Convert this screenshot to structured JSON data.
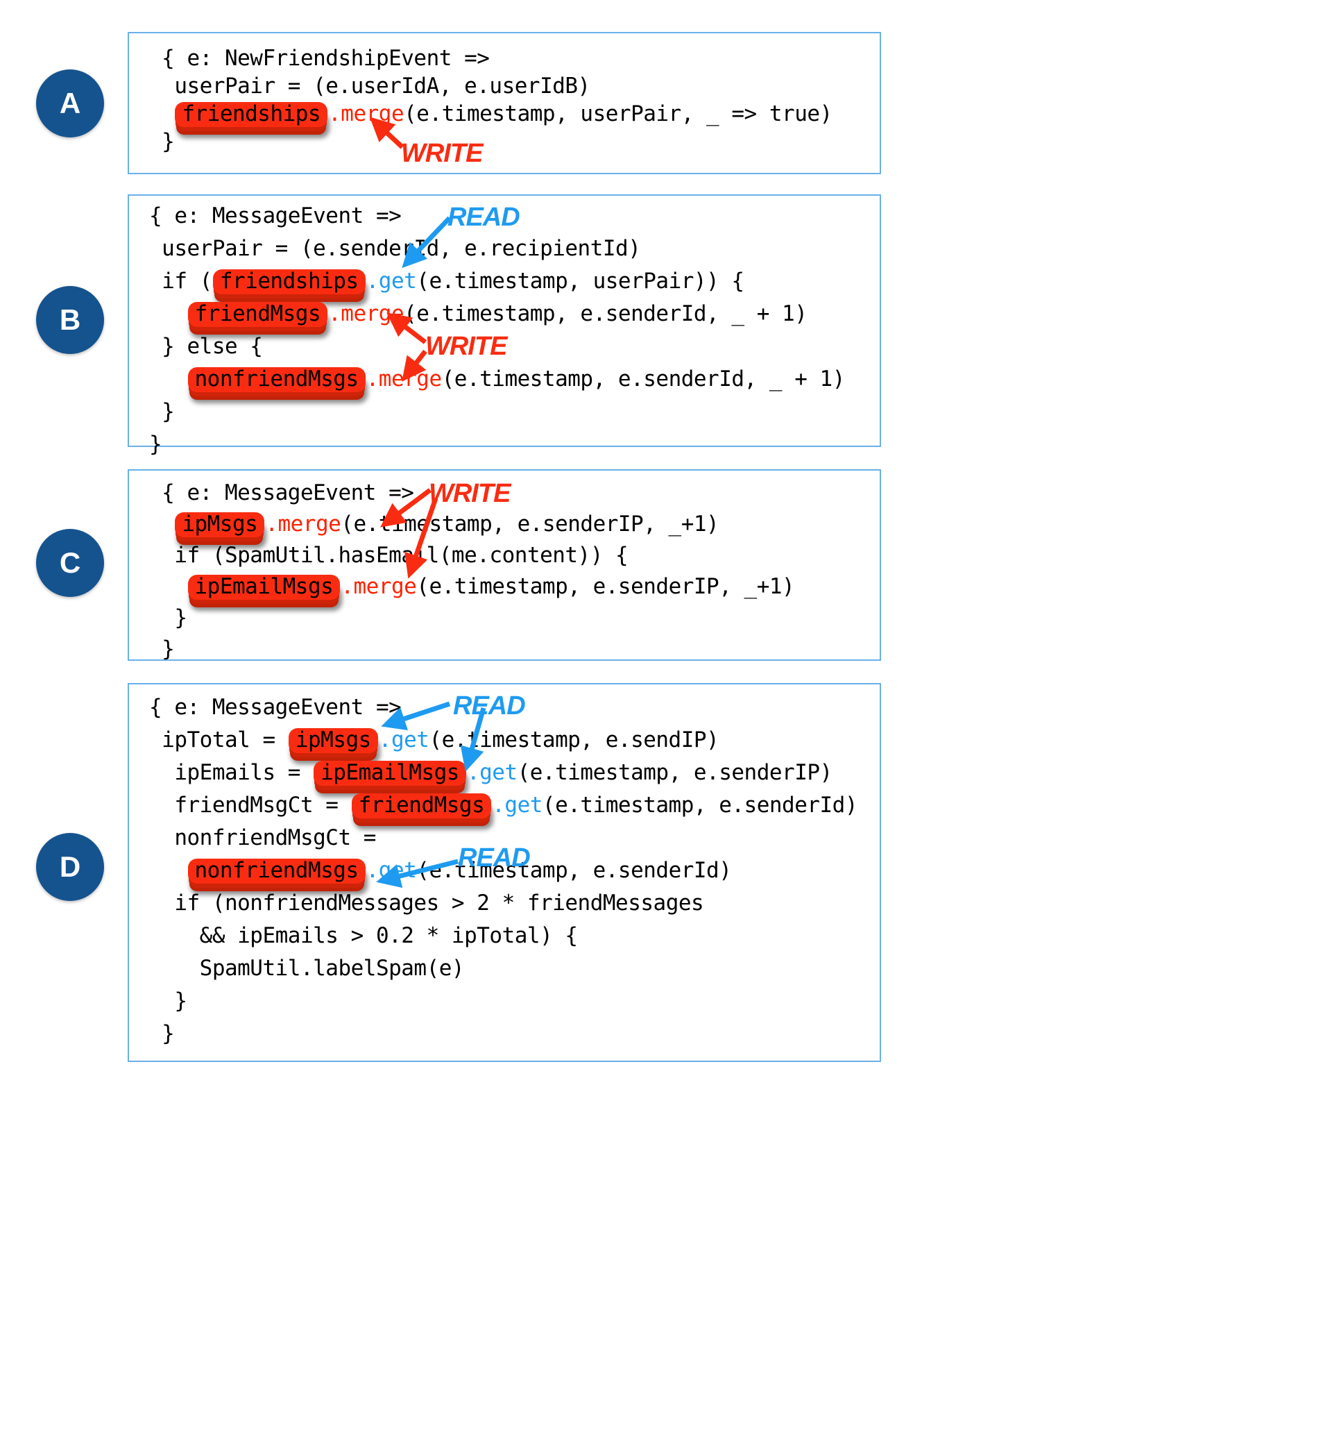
{
  "colors": {
    "panel_border": "#6ab0e8",
    "badge_fill": "#15538f",
    "pill_fill": "#f92c11",
    "pill_shadow": "#c22208",
    "write_color": "#f92c11",
    "read_color": "#1e9bf0",
    "background": "#ffffff",
    "code_color": "#000000"
  },
  "panels": [
    {
      "badge": "A",
      "lines": [
        [
          {
            "t": "plain",
            "v": " { e: NewFriendshipEvent =>"
          }
        ],
        [
          {
            "t": "plain",
            "v": "  userPair = (e.userIdA, e.userIdB)"
          }
        ],
        [
          {
            "t": "plain",
            "v": "  "
          },
          {
            "t": "pill",
            "v": "friendships"
          },
          {
            "t": "merge",
            "v": ".merge"
          },
          {
            "t": "plain",
            "v": "(e.timestamp, userPair, _ => true)"
          }
        ],
        [
          {
            "t": "plain",
            "v": " }"
          }
        ]
      ],
      "annotations": [
        {
          "label": "WRITE",
          "kind": "write"
        }
      ]
    },
    {
      "badge": "B",
      "lines": [
        [
          {
            "t": "plain",
            "v": "{ e: MessageEvent =>"
          }
        ],
        [
          {
            "t": "plain",
            "v": " userPair = (e.senderId, e.recipientId)"
          }
        ],
        [
          {
            "t": "plain",
            "v": " if ("
          },
          {
            "t": "pill",
            "v": "friendships"
          },
          {
            "t": "get",
            "v": ".get"
          },
          {
            "t": "plain",
            "v": "(e.timestamp, userPair)) {"
          }
        ],
        [
          {
            "t": "plain",
            "v": "   "
          },
          {
            "t": "pill",
            "v": "friendMsgs"
          },
          {
            "t": "merge",
            "v": ".merge"
          },
          {
            "t": "plain",
            "v": "(e.timestamp, e.senderId, _ + 1)"
          }
        ],
        [
          {
            "t": "plain",
            "v": " } else {"
          }
        ],
        [
          {
            "t": "plain",
            "v": "   "
          },
          {
            "t": "pill",
            "v": "nonfriendMsgs"
          },
          {
            "t": "merge",
            "v": ".merge"
          },
          {
            "t": "plain",
            "v": "(e.timestamp, e.senderId, _ + 1)"
          }
        ],
        [
          {
            "t": "plain",
            "v": " }"
          }
        ],
        [
          {
            "t": "plain",
            "v": "}"
          }
        ]
      ],
      "annotations": [
        {
          "label": "READ",
          "kind": "read"
        },
        {
          "label": "WRITE",
          "kind": "write"
        }
      ]
    },
    {
      "badge": "C",
      "lines": [
        [
          {
            "t": "plain",
            "v": " { e: MessageEvent =>"
          }
        ],
        [
          {
            "t": "plain",
            "v": "  "
          },
          {
            "t": "pill",
            "v": "ipMsgs"
          },
          {
            "t": "merge",
            "v": ".merge"
          },
          {
            "t": "plain",
            "v": "(e.timestamp, e.senderIP, _+1)"
          }
        ],
        [
          {
            "t": "plain",
            "v": "  if (SpamUtil.hasEmail(me.content)) {"
          }
        ],
        [
          {
            "t": "plain",
            "v": "   "
          },
          {
            "t": "pill",
            "v": "ipEmailMsgs"
          },
          {
            "t": "merge",
            "v": ".merge"
          },
          {
            "t": "plain",
            "v": "(e.timestamp, e.senderIP, _+1)"
          }
        ],
        [
          {
            "t": "plain",
            "v": "  }"
          }
        ],
        [
          {
            "t": "plain",
            "v": " }"
          }
        ]
      ],
      "annotations": [
        {
          "label": "WRITE",
          "kind": "write"
        }
      ]
    },
    {
      "badge": "D",
      "lines": [
        [
          {
            "t": "plain",
            "v": "{ e: MessageEvent =>"
          }
        ],
        [
          {
            "t": "plain",
            "v": " ipTotal = "
          },
          {
            "t": "pill",
            "v": "ipMsgs"
          },
          {
            "t": "get",
            "v": ".get"
          },
          {
            "t": "plain",
            "v": "(e.timestamp, e.sendIP)"
          }
        ],
        [
          {
            "t": "plain",
            "v": "  ipEmails = "
          },
          {
            "t": "pill",
            "v": "ipEmailMsgs"
          },
          {
            "t": "get",
            "v": ".get"
          },
          {
            "t": "plain",
            "v": "(e.timestamp, e.senderIP)"
          }
        ],
        [
          {
            "t": "plain",
            "v": "  friendMsgCt = "
          },
          {
            "t": "pill",
            "v": "friendMsgs"
          },
          {
            "t": "get",
            "v": ".get"
          },
          {
            "t": "plain",
            "v": "(e.timestamp, e.senderId)"
          }
        ],
        [
          {
            "t": "plain",
            "v": "  nonfriendMsgCt ="
          }
        ],
        [
          {
            "t": "plain",
            "v": "   "
          },
          {
            "t": "pill",
            "v": "nonfriendMsgs"
          },
          {
            "t": "get",
            "v": ".get"
          },
          {
            "t": "plain",
            "v": "(e.timestamp, e.senderId)"
          }
        ],
        [
          {
            "t": "plain",
            "v": "  if (nonfriendMessages > 2 * friendMessages"
          }
        ],
        [
          {
            "t": "plain",
            "v": "    && ipEmails > 0.2 * ipTotal) {"
          }
        ],
        [
          {
            "t": "plain",
            "v": "    SpamUtil.labelSpam(e)"
          }
        ],
        [
          {
            "t": "plain",
            "v": "  }"
          }
        ],
        [
          {
            "t": "plain",
            "v": " }"
          }
        ]
      ],
      "annotations": [
        {
          "label": "READ",
          "kind": "read"
        },
        {
          "label": "READ",
          "kind": "read"
        }
      ]
    }
  ],
  "annotation_labels": {
    "a_write": "WRITE",
    "b_read": "READ",
    "b_write": "WRITE",
    "c_write": "WRITE",
    "d_read_top": "READ",
    "d_read_bottom": "READ"
  },
  "badges": {
    "a": "A",
    "b": "B",
    "c": "C",
    "d": "D"
  }
}
